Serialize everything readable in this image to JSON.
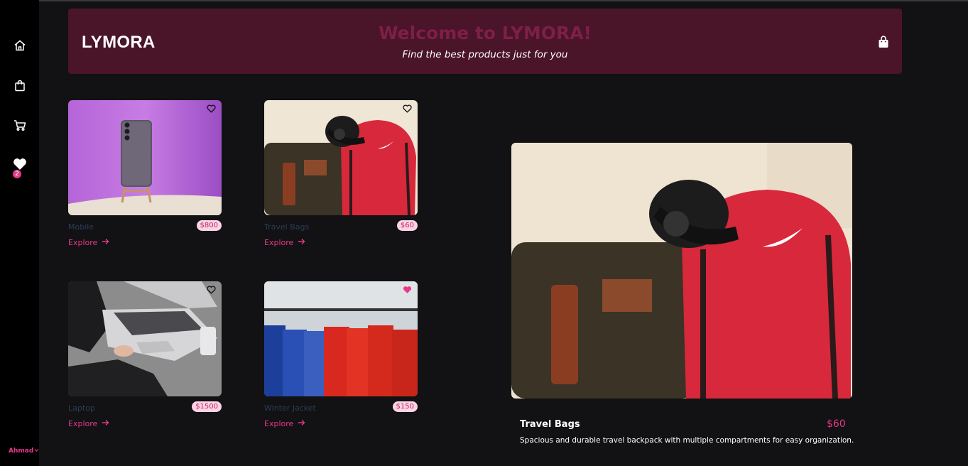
{
  "sidebar": {
    "items": [
      {
        "icon": "home-icon"
      },
      {
        "icon": "shopping-bag-icon"
      },
      {
        "icon": "cart-icon"
      },
      {
        "icon": "heart-icon"
      }
    ],
    "favorites_count": "2",
    "user_name": "Ahmad"
  },
  "header": {
    "logo": "LYMORA",
    "welcome": "Welcome to LYMORA!",
    "tagline": "Find the best products just for you"
  },
  "products": [
    {
      "name": "Mobile",
      "price": "$800",
      "explore": "Explore",
      "favorited": false
    },
    {
      "name": "Travel Bags",
      "price": "$60",
      "explore": "Explore",
      "favorited": false
    },
    {
      "name": "Laptop",
      "price": "$1500",
      "explore": "Explore",
      "favorited": false
    },
    {
      "name": "Winter Jacket",
      "price": "$150",
      "explore": "Explore",
      "favorited": true
    }
  ],
  "detail": {
    "name": "Travel Bags",
    "price": "$60",
    "description": "Spacious and durable travel backpack with multiple compartments for easy organization."
  },
  "colors": {
    "accent": "#e6398a",
    "header_bg": "#4a1429",
    "page_bg": "#121113",
    "sidebar_bg": "#000000"
  }
}
